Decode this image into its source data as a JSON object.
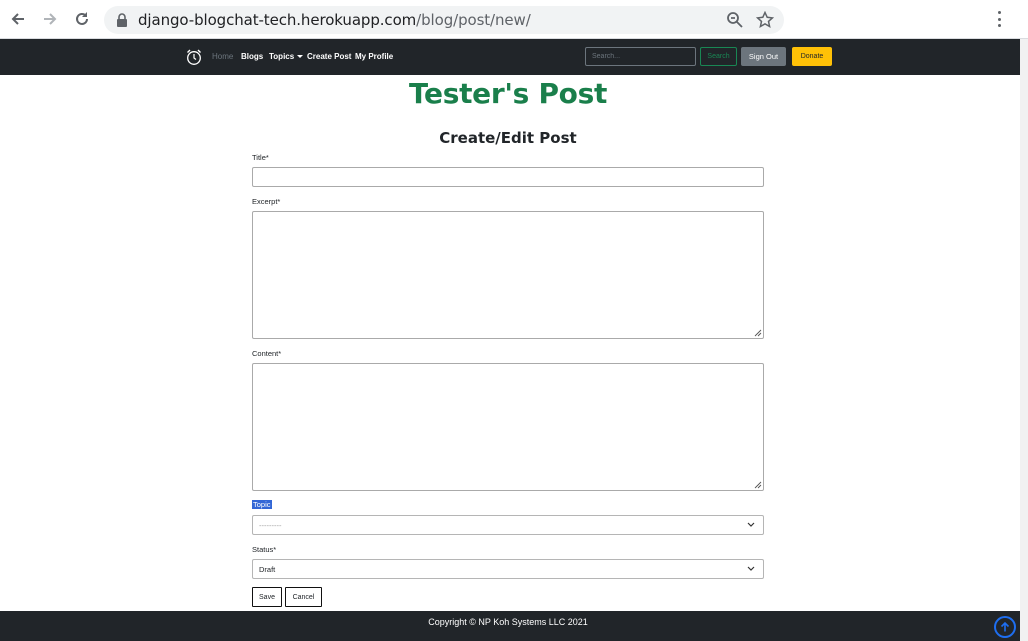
{
  "browser": {
    "url_host": "django-blogchat-tech.herokuapp.com",
    "url_path": "/blog/post/new/"
  },
  "navbar": {
    "home": "Home",
    "blogs": "Blogs",
    "topics": "Topics",
    "create_post": "Create Post",
    "my_profile": "My Profile",
    "search_placeholder": "Search...",
    "search_button": "Search",
    "sign_out": "Sign Out",
    "donate": "Donate"
  },
  "page": {
    "site_title": "Tester's Post",
    "form_heading": "Create/Edit Post"
  },
  "form": {
    "title_label": "Title*",
    "title_value": "",
    "excerpt_label": "Excerpt*",
    "excerpt_value": "",
    "content_label": "Content*",
    "content_value": "",
    "topic_label": "Topic",
    "topic_selected": "---------",
    "status_label": "Status*",
    "status_selected": "Draft",
    "save_button": "Save",
    "cancel_button": "Cancel"
  },
  "footer": {
    "copyright": "Copyright © NP Koh Systems LLC 2021"
  },
  "colors": {
    "navbar_bg": "#212529",
    "title_green": "#1a7f4b",
    "search_green": "#198754",
    "donate_yellow": "#ffc107",
    "signout_gray": "#6c757d",
    "to_top_blue": "#1e6ef0"
  },
  "icons": {
    "back": "arrow-left-icon",
    "forward": "arrow-right-icon",
    "reload": "reload-icon",
    "lock": "lock-icon",
    "zoom": "zoom-icon",
    "bookmark": "star-icon",
    "menu": "kebab-menu-icon",
    "brand": "alarm-clock-icon",
    "to_top": "arrow-up-circle-icon"
  }
}
